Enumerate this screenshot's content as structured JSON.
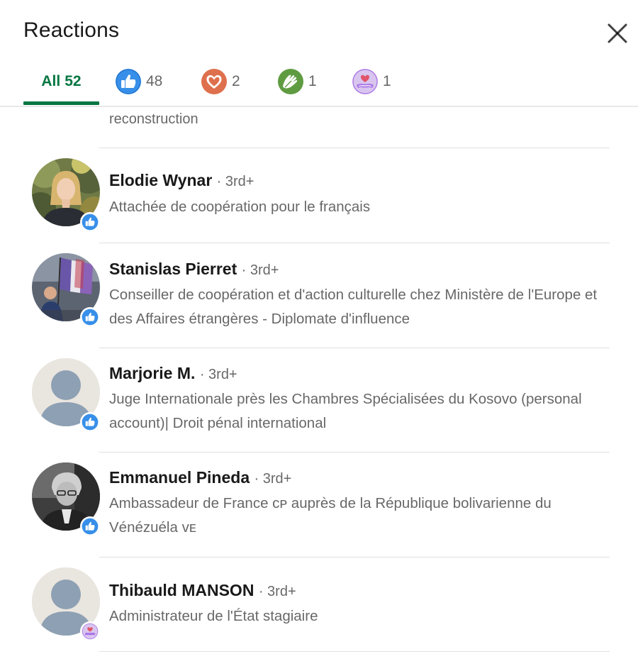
{
  "dialog": {
    "title": "Reactions",
    "close_icon": "close-x-icon"
  },
  "tabs": [
    {
      "label": "All",
      "count": "52",
      "icon": "",
      "active": true
    },
    {
      "label": "",
      "count": "48",
      "icon": "like-icon",
      "color": "#378fe9"
    },
    {
      "label": "",
      "count": "2",
      "icon": "love-icon",
      "color": "#df704d"
    },
    {
      "label": "",
      "count": "1",
      "icon": "support-icon",
      "color": "#5f9b41"
    },
    {
      "label": "",
      "count": "1",
      "icon": "celebrate-icon",
      "color": "#a872e8"
    }
  ],
  "partial_row": {
    "headline": "reconstruction"
  },
  "people": [
    {
      "name": "Elodie Wynar",
      "degree": "· 3rd+",
      "headline": "Attachée de coopération pour le français",
      "reaction": "like-icon",
      "avatar": "photo-woman"
    },
    {
      "name": "Stanislas Pierret",
      "degree": "· 3rd+",
      "headline": "Conseiller de coopération et d'action culturelle chez Ministère de l'Europe et des Affaires étrangères - Diplomate d'influence",
      "reaction": "like-icon",
      "avatar": "photo-flags"
    },
    {
      "name": "Marjorie M.",
      "degree": "· 3rd+",
      "headline": "Juge Internationale près les Chambres Spécialisées du Kosovo (personal account)| Droit pénal international",
      "reaction": "like-icon",
      "avatar": "placeholder"
    },
    {
      "name": "Emmanuel Pineda",
      "degree": "· 3rd+",
      "headline": "Ambassadeur de France ᴄᴘ auprès de la République bolivarienne du Vénézuéla ᴠᴇ",
      "reaction": "like-icon",
      "avatar": "photo-man-bw"
    },
    {
      "name": "Thibauld MANSON",
      "degree": "· 3rd+",
      "headline": "Administrateur de l'État stagiaire",
      "reaction": "celebrate-icon",
      "avatar": "placeholder"
    }
  ],
  "colors": {
    "accent_green": "#057642",
    "like_blue": "#378fe9",
    "love_orange": "#df704d",
    "support_green": "#5f9b41",
    "celebrate_purple": "#a872e8"
  }
}
